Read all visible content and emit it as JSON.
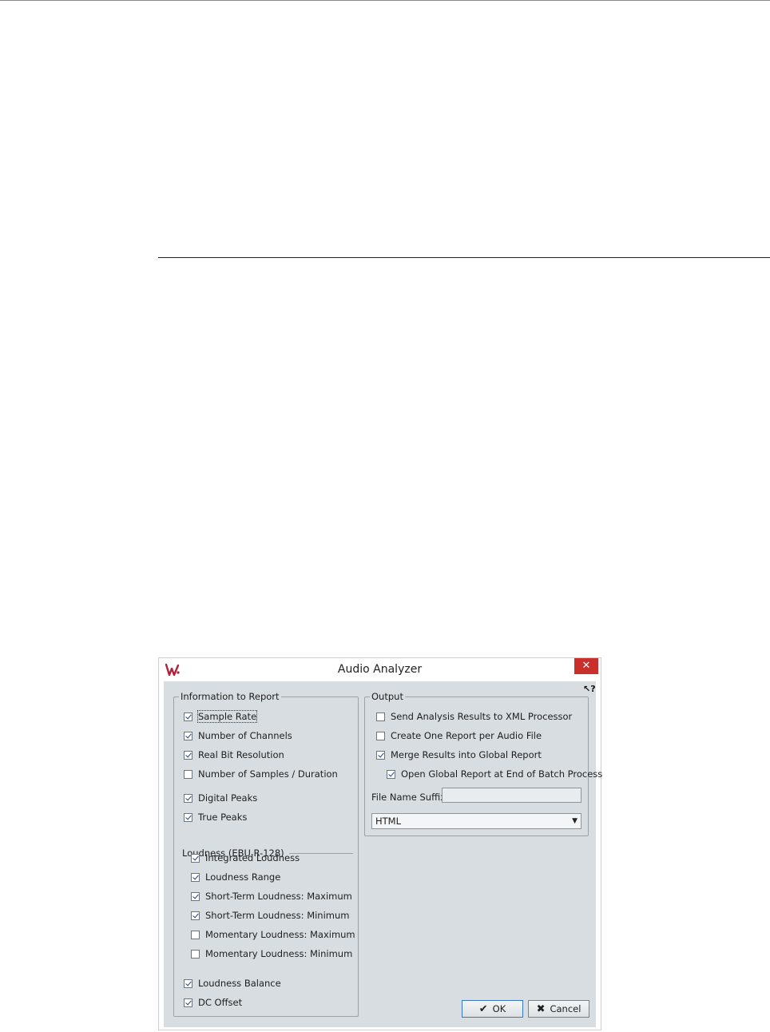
{
  "dialog": {
    "title": "Audio Analyzer",
    "close_glyph": "✕",
    "help_glyph": "↖?"
  },
  "info_group": {
    "title": "Information to Report",
    "items": [
      {
        "label": "Sample Rate",
        "checked": true
      },
      {
        "label": "Number of Channels",
        "checked": true
      },
      {
        "label": "Real Bit Resolution",
        "checked": true
      },
      {
        "label": "Number of Samples / Duration",
        "checked": false
      },
      {
        "label": "Digital Peaks",
        "checked": true
      },
      {
        "label": "True Peaks",
        "checked": true
      }
    ],
    "loudness_title": "Loudness (EBU R-128)",
    "loudness_items": [
      {
        "label": "Integrated Loudness",
        "checked": true
      },
      {
        "label": "Loudness Range",
        "checked": true
      },
      {
        "label": "Short-Term Loudness: Maximum",
        "checked": true
      },
      {
        "label": "Short-Term Loudness: Minimum",
        "checked": true
      },
      {
        "label": "Momentary Loudness: Maximum",
        "checked": false
      },
      {
        "label": "Momentary Loudness: Minimum",
        "checked": false
      }
    ],
    "extra_items": [
      {
        "label": "Loudness Balance",
        "checked": true
      },
      {
        "label": "DC Offset",
        "checked": true
      }
    ]
  },
  "output_group": {
    "title": "Output",
    "items": [
      {
        "label": "Send Analysis Results to XML Processor",
        "checked": false
      },
      {
        "label": "Create One Report per Audio File",
        "checked": false
      },
      {
        "label": "Merge Results into Global Report",
        "checked": true
      },
      {
        "label": "Open Global Report at End of Batch Process",
        "checked": true
      }
    ],
    "suffix_label": "File Name Suffix",
    "suffix_value": "",
    "format_value": "HTML",
    "format_arrow": "▼"
  },
  "buttons": {
    "ok_label": "OK",
    "ok_glyph": "✔",
    "cancel_label": "Cancel",
    "cancel_glyph": "✖"
  }
}
